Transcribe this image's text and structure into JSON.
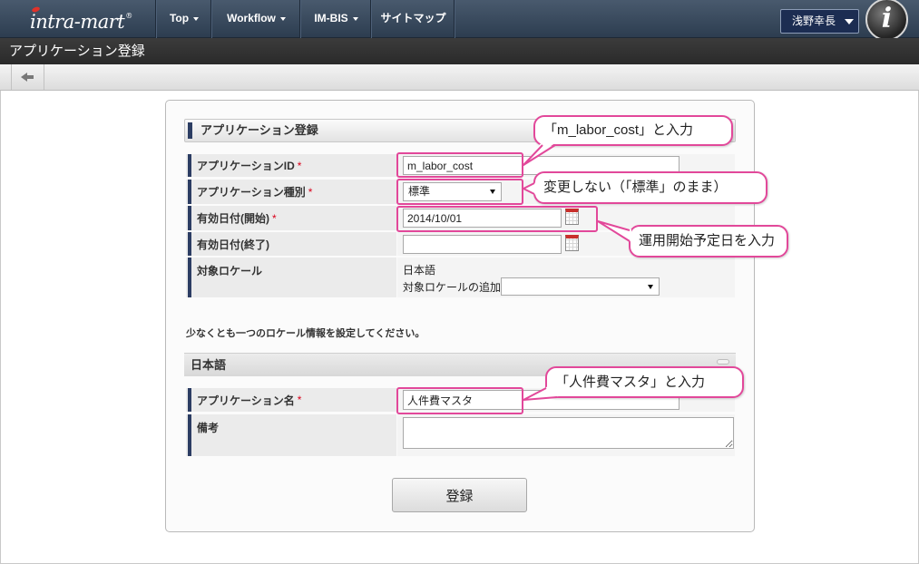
{
  "app": {
    "logo_text": "intra-mart",
    "logo_mark": "®",
    "badge_text": "i"
  },
  "nav": {
    "items": [
      {
        "label": "Top",
        "icon": "chevron-down-icon"
      },
      {
        "label": "Workflow",
        "icon": "chevron-down-icon"
      },
      {
        "label": "IM-BIS",
        "icon": "chevron-down-icon"
      },
      {
        "label": "サイトマップ"
      }
    ]
  },
  "user": {
    "name": "浅野幸長",
    "icon": "chevron-down-icon"
  },
  "page": {
    "title": "アプリケーション登録"
  },
  "toolbar": {
    "back_icon": "back-arrow-icon"
  },
  "form": {
    "section_title": "アプリケーション登録",
    "app_id": {
      "label": "アプリケーションID",
      "required": "*",
      "value": "m_labor_cost"
    },
    "app_type": {
      "label": "アプリケーション種別",
      "required": "*",
      "selected": "標準",
      "icon": "dropdown-arrow-icon"
    },
    "start_date": {
      "label": "有効日付(開始)",
      "required": "*",
      "value": "2014/10/01",
      "icon": "calendar-icon"
    },
    "end_date": {
      "label": "有効日付(終了)",
      "value": "",
      "icon": "calendar-icon"
    },
    "locale": {
      "label": "対象ロケール",
      "value": "日本語",
      "add_label": "対象ロケールの追加",
      "add_selected": "",
      "icon": "dropdown-arrow-icon"
    },
    "notice": "少なくとも一つのロケール情報を設定してください。",
    "locale_section": {
      "title": "日本語",
      "collapse_icon": "collapse-icon",
      "app_name": {
        "label": "アプリケーション名",
        "required": "*",
        "value": "人件費マスタ"
      },
      "remarks": {
        "label": "備考",
        "value": ""
      }
    },
    "submit_label": "登録"
  },
  "annotations": [
    {
      "text": "「m_labor_cost」と入力"
    },
    {
      "text": "変更しない（「標準」のまま）"
    },
    {
      "text": "運用開始予定日を入力"
    },
    {
      "text": "「人件費マスタ」と入力"
    }
  ],
  "colors": {
    "nav_bg": "#34475d",
    "title_bar_bg": "#2f2f2f",
    "label_bar": "#2c3d63",
    "required": "#d9001b",
    "annotation": "#e2489a"
  }
}
